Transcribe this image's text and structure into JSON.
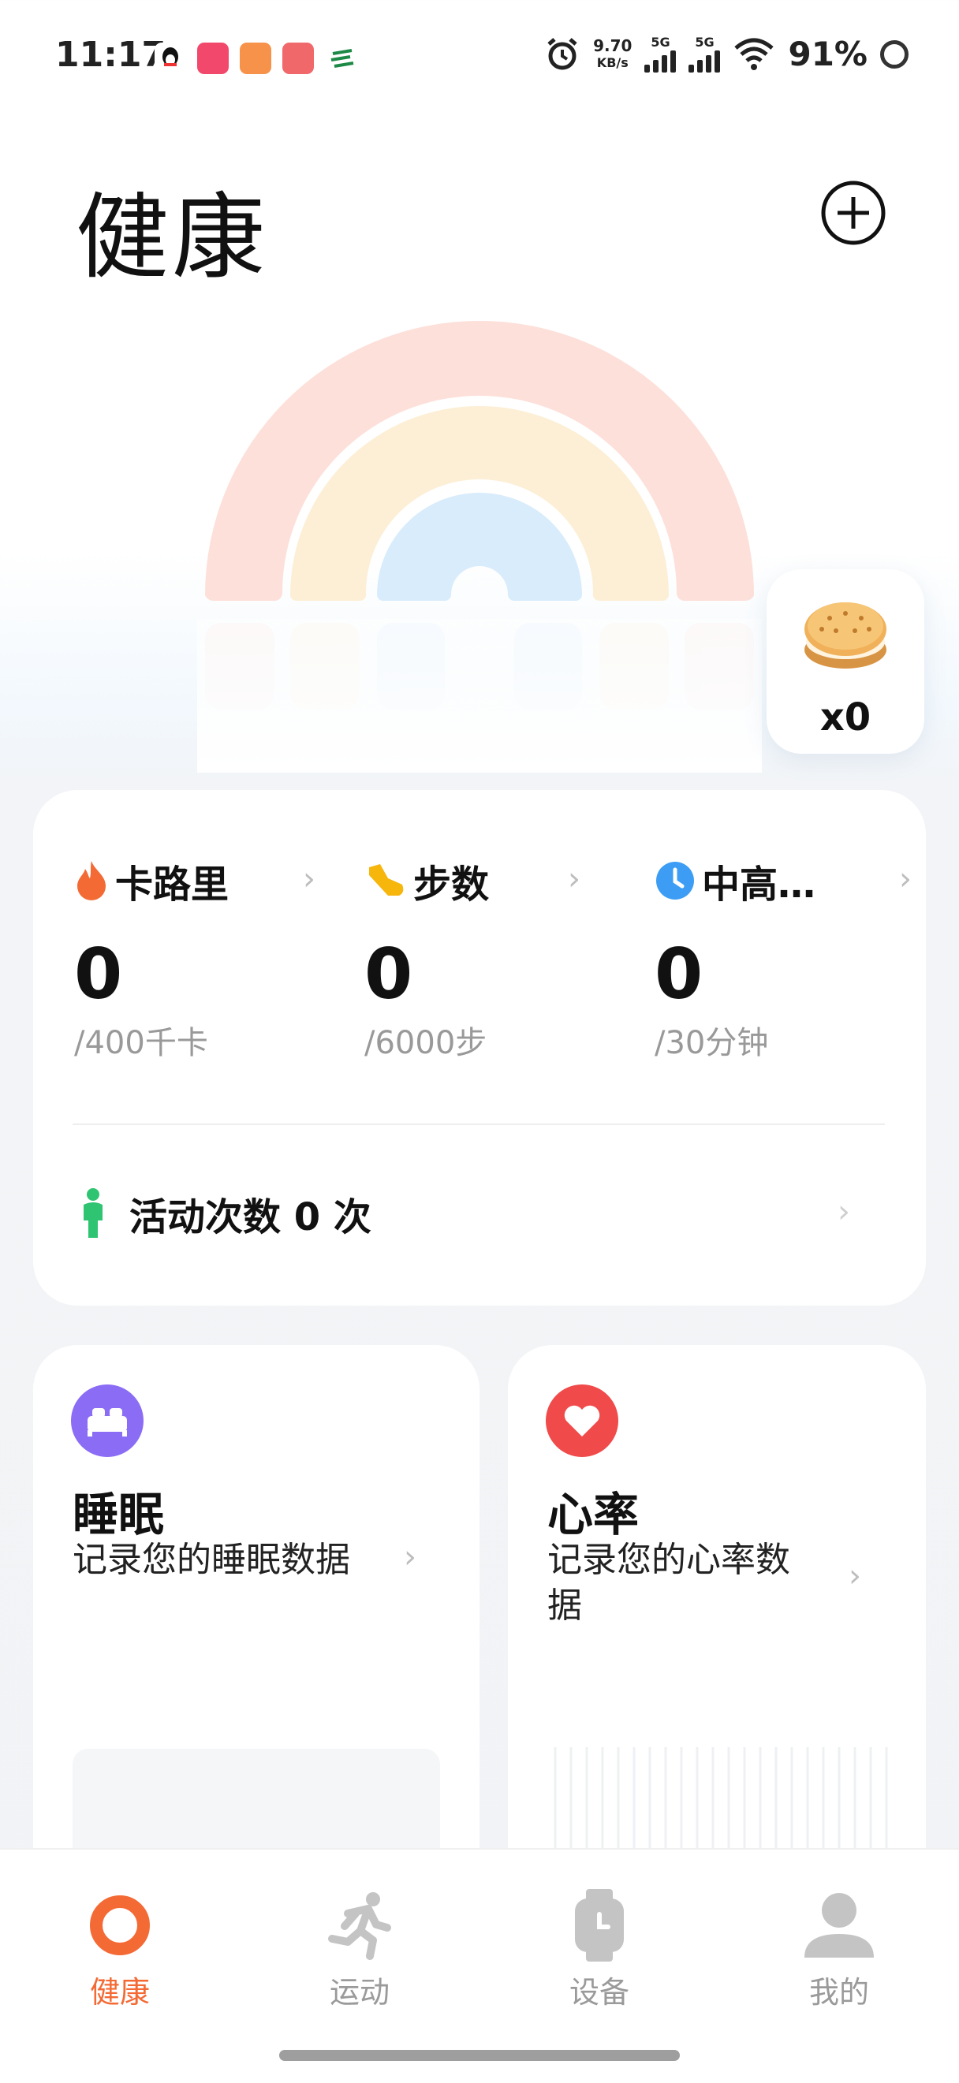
{
  "status_bar": {
    "time": "11:17",
    "net_speed_value": "9.70",
    "net_speed_unit": "KB/s",
    "sim1_label": "5G",
    "sim2_label": "5G",
    "battery": "91%"
  },
  "header": {
    "title": "健康"
  },
  "reward": {
    "count": "x0"
  },
  "activity": {
    "metrics": [
      {
        "label": "卡路里",
        "value": "0",
        "goal": "/400千卡",
        "icon": "flame-icon",
        "color": "#f46a35"
      },
      {
        "label": "步数",
        "value": "0",
        "goal": "/6000步",
        "icon": "shoe-icon",
        "color": "#f6b60c"
      },
      {
        "label": "中高…",
        "value": "0",
        "goal": "/30分钟",
        "icon": "clock-icon",
        "color": "#3d9df5"
      }
    ],
    "count_row": {
      "label": "活动次数",
      "value": "0",
      "unit": "次"
    }
  },
  "sleep_card": {
    "title": "睡眠",
    "subtitle": "记录您的睡眠数据",
    "color": "#8b6cf5"
  },
  "heart_card": {
    "title": "心率",
    "subtitle_line1": "记录您的心率数",
    "subtitle_line2": "据",
    "color": "#f04a4a"
  },
  "tabs": [
    {
      "label": "健康",
      "active": true
    },
    {
      "label": "运动",
      "active": false
    },
    {
      "label": "设备",
      "active": false
    },
    {
      "label": "我的",
      "active": false
    }
  ],
  "colors": {
    "accent": "#f46a35",
    "inactive": "#9a9a9a"
  }
}
